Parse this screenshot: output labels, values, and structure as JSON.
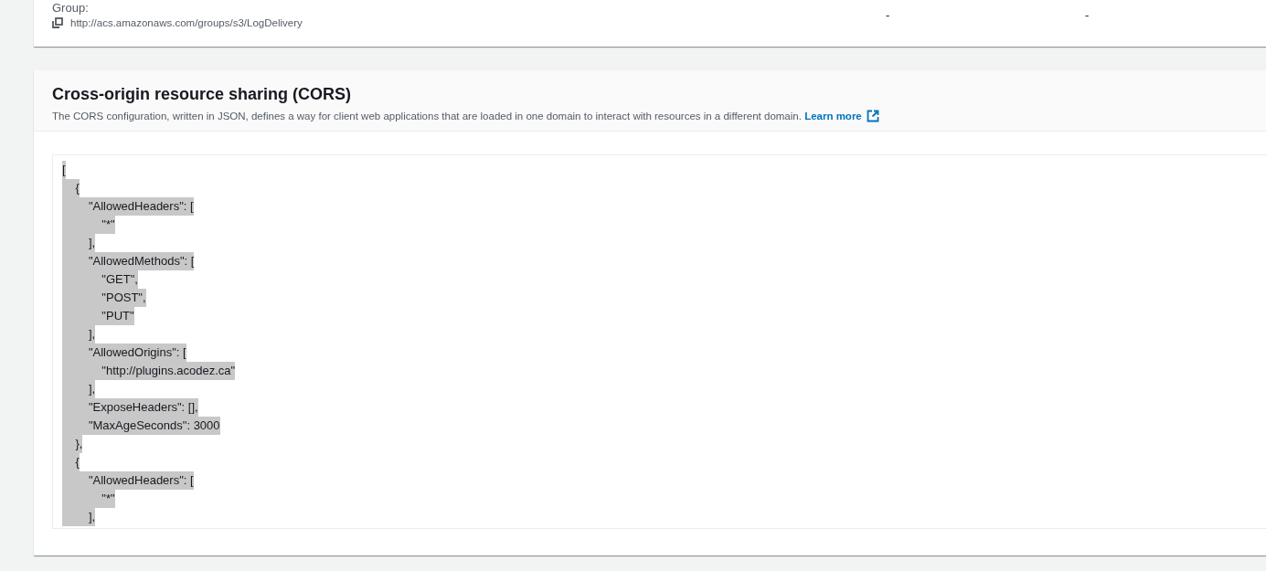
{
  "grantee_card": {
    "label": "Group:",
    "uri": "http://acs.amazonaws.com/groups/s3/LogDelivery",
    "values": [
      "-",
      "-"
    ]
  },
  "cors": {
    "title": "Cross-origin resource sharing (CORS)",
    "description": "The CORS configuration, written in JSON, defines a way for client web applications that are loaded in one domain to interact with resources in a different domain.",
    "link": "Learn more",
    "code": {
      "selected": true,
      "lines": [
        "[",
        "    {",
        "        \"AllowedHeaders\": [",
        "            \"*\"",
        "        ],",
        "        \"AllowedMethods\": [",
        "            \"GET\",",
        "            \"POST\",",
        "            \"PUT\"",
        "        ],",
        "        \"AllowedOrigins\": [",
        "            \"http://plugins.acodez.ca\"",
        "        ],",
        "        \"ExposeHeaders\": [],",
        "        \"MaxAgeSeconds\": 3000",
        "    },",
        "    {",
        "        \"AllowedHeaders\": [",
        "            \"*\"",
        "        ],"
      ]
    }
  }
}
